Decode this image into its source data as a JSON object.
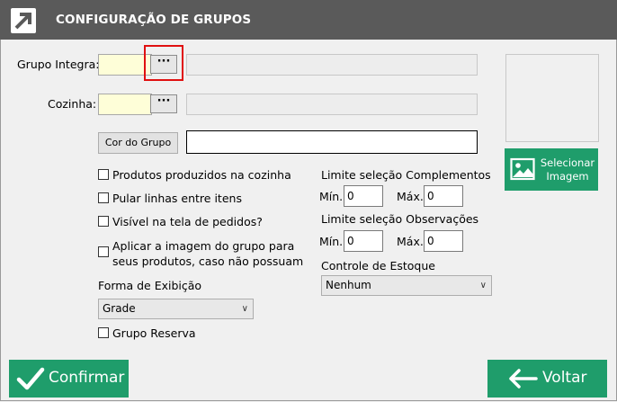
{
  "window": {
    "title": "CONFIGURAÇÃO DE GRUPOS"
  },
  "form": {
    "grupo_integra_label": "Grupo Integra:",
    "cozinha_label": "Cozinha:",
    "browse_label": "···",
    "cor_do_grupo_button": "Cor do Grupo"
  },
  "checkboxes": {
    "produtos_cozinha": "Produtos produzidos na cozinha",
    "pular_linhas": "Pular linhas entre itens",
    "visivel_pedidos": "Visível na tela de pedidos?",
    "aplicar_imagem_1": "Aplicar a imagem do grupo para",
    "aplicar_imagem_2": "seus produtos, caso não possuam",
    "grupo_reserva": "Grupo Reserva"
  },
  "exibicao": {
    "label": "Forma de Exibição",
    "value": "Grade"
  },
  "complementos": {
    "label": "Limite seleção Complementos",
    "min_label": "Mín.",
    "min_value": "0",
    "max_label": "Máx.",
    "max_value": "0"
  },
  "observacoes": {
    "label": "Limite seleção Observações",
    "min_label": "Mín.",
    "min_value": "0",
    "max_label": "Máx.",
    "max_value": "0"
  },
  "estoque": {
    "label": "Controle de Estoque",
    "value": "Nenhum"
  },
  "image": {
    "select_line1": "Selecionar",
    "select_line2": "Imagem"
  },
  "footer": {
    "confirm_label": "Confirmar",
    "back_label": "Voltar"
  },
  "colors": {
    "accent": "#1f9d6b",
    "titlebar": "#5a5a5a",
    "highlight": "#e01010",
    "input_yellow": "#fefed8"
  }
}
